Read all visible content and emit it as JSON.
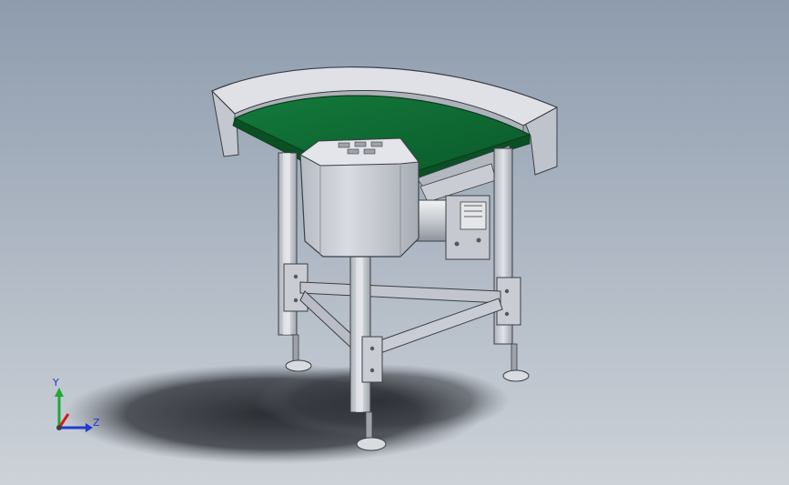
{
  "viewport": {
    "background_top": "#8e9cae",
    "background_bottom": "#cdd2d8"
  },
  "model": {
    "belt_color": "#0e6a33",
    "frame_color": "#c9ccd3",
    "shadow_color": "#2a2d33"
  },
  "triad": {
    "y_label": "Y",
    "z_label": "Z",
    "x_color": "#d81b1b",
    "y_color": "#1ea836",
    "z_color": "#1f3bd1"
  }
}
